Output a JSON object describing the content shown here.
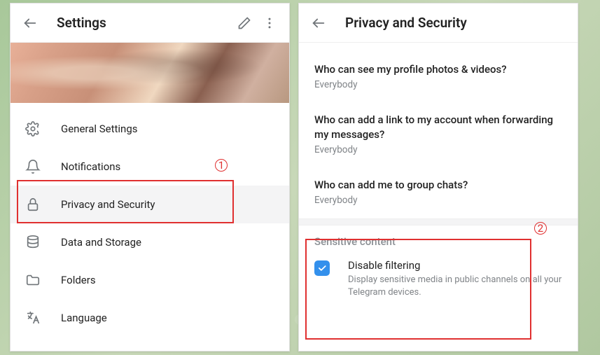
{
  "left": {
    "title": "Settings",
    "menu": [
      {
        "icon": "gear",
        "label": "General Settings"
      },
      {
        "icon": "bell",
        "label": "Notifications"
      },
      {
        "icon": "lock",
        "label": "Privacy and Security"
      },
      {
        "icon": "database",
        "label": "Data and Storage"
      },
      {
        "icon": "folder",
        "label": "Folders"
      },
      {
        "icon": "language",
        "label": "Language"
      }
    ]
  },
  "right": {
    "title": "Privacy and Security",
    "settings": [
      {
        "title": "Who can see my profile photos & videos?",
        "value": "Everybody"
      },
      {
        "title": "Who can add a link to my account when forwarding my messages?",
        "value": "Everybody"
      },
      {
        "title": "Who can add me to group chats?",
        "value": "Everybody"
      }
    ],
    "sensitive": {
      "header": "Sensitive content",
      "checkbox_label": "Disable filtering",
      "checkbox_desc": "Display sensitive media in public channels on all your Telegram devices.",
      "checked": true
    }
  },
  "annotations": {
    "one": "1",
    "two": "2"
  }
}
